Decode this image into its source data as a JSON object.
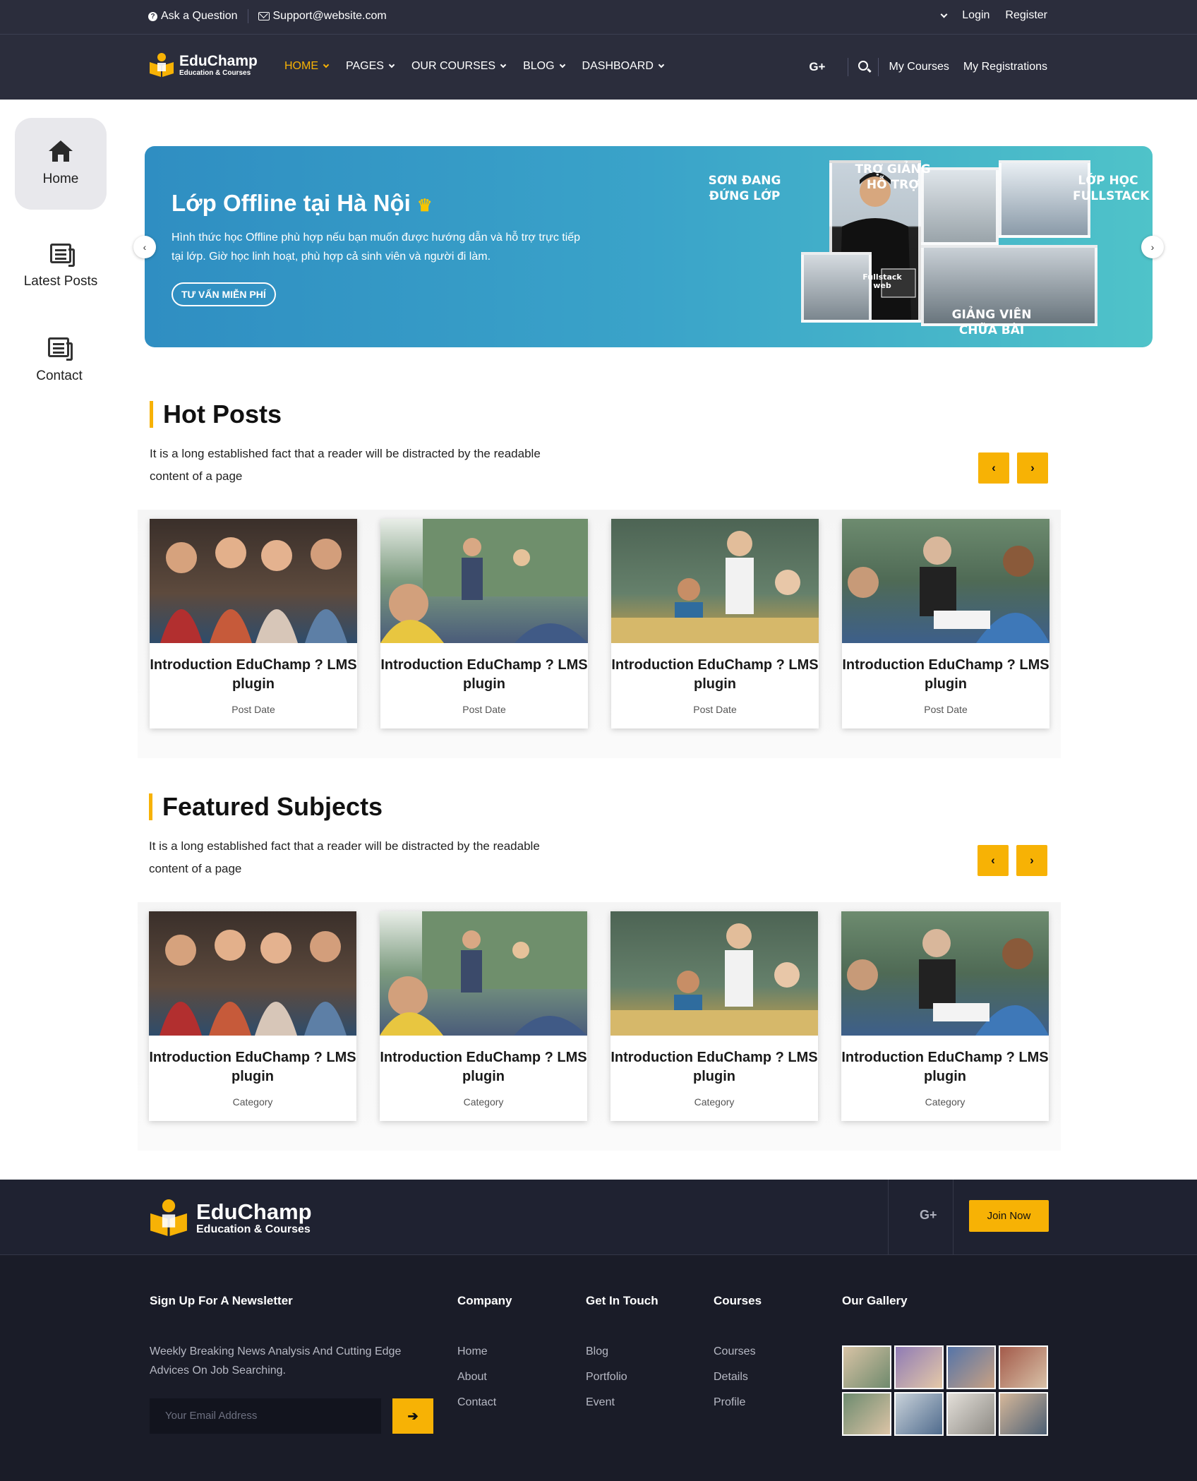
{
  "topbar": {
    "ask_label": "Ask a Question",
    "support_email": "Support@website.com",
    "login_label": "Login",
    "register_label": "Register"
  },
  "nav": {
    "logo_name": "EduChamp",
    "logo_tagline": "Education & Courses",
    "menu": [
      {
        "label": "HOME"
      },
      {
        "label": "PAGES"
      },
      {
        "label": "OUR COURSES"
      },
      {
        "label": "BLOG"
      },
      {
        "label": "DASHBOARD"
      }
    ],
    "social_label": "G+",
    "my_courses_label": "My Courses",
    "my_registrations_label": "My Registrations"
  },
  "sidebar": {
    "items": [
      {
        "label": "Home",
        "icon": "home-icon"
      },
      {
        "label": "Latest Posts",
        "icon": "newspaper-icon"
      },
      {
        "label": "Contact",
        "icon": "newspaper-icon"
      }
    ]
  },
  "banner": {
    "title": "Lớp Offline tại Hà Nội",
    "description": "Hình thức học Offline phù hợp nếu bạn muốn được hướng dẫn và hỗ trợ trực tiếp tại lớp. Giờ học linh hoạt, phù hợp cả sinh viên và người đi làm.",
    "cta_label": "TƯ VẤN MIỄN PHÍ",
    "captions": {
      "top_left": "SƠN ĐANG ĐỨNG LỚP",
      "top_middle": "TRỢ GIẢNG HỖ TRỢ",
      "top_right": "LỚP HỌC FULLSTACK",
      "bottom": "GIẢNG VIÊN CHỮA BÀI",
      "board": "Fullstack web"
    }
  },
  "hot_posts": {
    "title": "Hot Posts",
    "description": "It is a long established fact that a reader will be distracted by the readable content of a page",
    "cards": [
      {
        "title": "Introduction EduChamp ? LMS plugin",
        "meta": "Post Date"
      },
      {
        "title": "Introduction EduChamp ? LMS plugin",
        "meta": "Post Date"
      },
      {
        "title": "Introduction EduChamp ? LMS plugin",
        "meta": "Post Date"
      },
      {
        "title": "Introduction EduChamp ? LMS plugin",
        "meta": "Post Date"
      }
    ]
  },
  "featured": {
    "title": "Featured Subjects",
    "description": "It is a long established fact that a reader will be distracted by the readable content of a page",
    "cards": [
      {
        "title": "Introduction EduChamp ? LMS plugin",
        "meta": "Category"
      },
      {
        "title": "Introduction EduChamp ? LMS plugin",
        "meta": "Category"
      },
      {
        "title": "Introduction EduChamp ? LMS plugin",
        "meta": "Category"
      },
      {
        "title": "Introduction EduChamp ? LMS plugin",
        "meta": "Category"
      }
    ]
  },
  "footer": {
    "logo_name": "EduChamp",
    "logo_tagline": "Education & Courses",
    "social_label": "G+",
    "join_label": "Join Now",
    "newsletter": {
      "heading": "Sign Up For A Newsletter",
      "text": "Weekly Breaking News Analysis And Cutting Edge Advices On Job Searching.",
      "email_placeholder": "Your Email Address"
    },
    "columns": [
      {
        "heading": "Company",
        "links": [
          "Home",
          "About",
          "Contact"
        ]
      },
      {
        "heading": "Get In Touch",
        "links": [
          "Blog",
          "Portfolio",
          "Event"
        ]
      },
      {
        "heading": "Courses",
        "links": [
          "Courses",
          "Details",
          "Profile"
        ]
      }
    ],
    "gallery_heading": "Our Gallery"
  },
  "colors": {
    "accent": "#f7b205",
    "header_bg": "#2b2d3c",
    "footer_bg": "#1a1c28",
    "banner_start": "#2f8ec2",
    "banner_end": "#4fc3c9"
  }
}
